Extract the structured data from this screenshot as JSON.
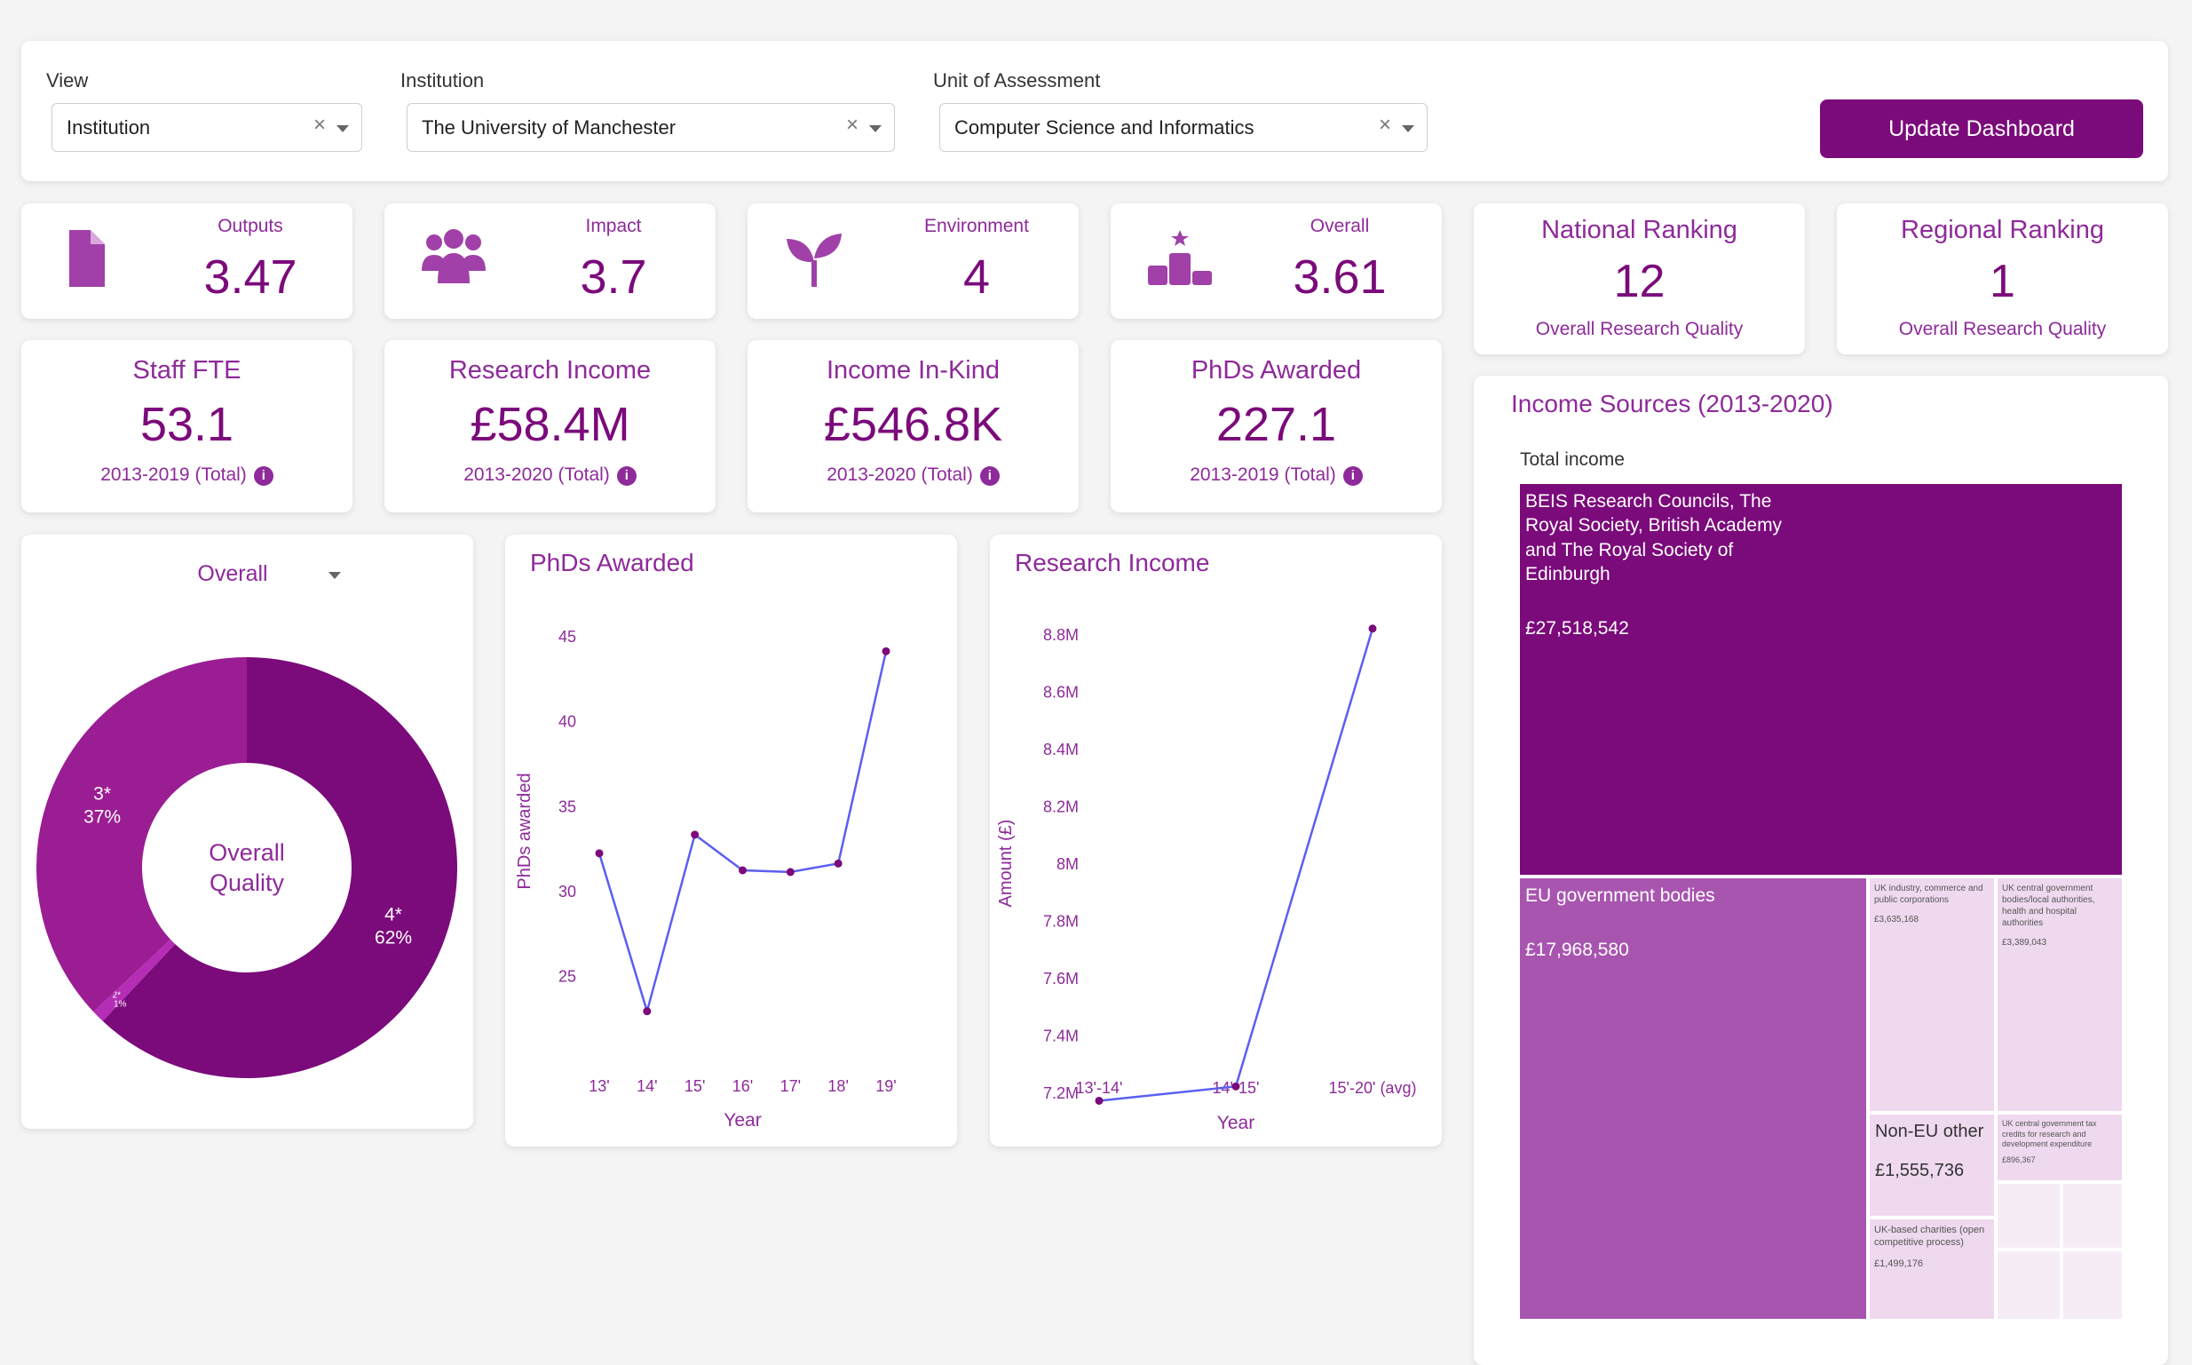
{
  "filters": {
    "view": {
      "label": "View",
      "value": "Institution"
    },
    "institution": {
      "label": "Institution",
      "value": "The University of Manchester"
    },
    "unit": {
      "label": "Unit of Assessment",
      "value": "Computer Science and Informatics"
    },
    "clear_glyph": "×",
    "update_label": "Update Dashboard"
  },
  "scores": [
    {
      "label": "Outputs",
      "value": "3.47",
      "icon": "document-icon"
    },
    {
      "label": "Impact",
      "value": "3.7",
      "icon": "people-icon"
    },
    {
      "label": "Environment",
      "value": "4",
      "icon": "sprout-icon"
    },
    {
      "label": "Overall",
      "value": "3.61",
      "icon": "podium-icon"
    }
  ],
  "rankings": [
    {
      "label": "National Ranking",
      "value": "12",
      "sub": "Overall Research Quality"
    },
    {
      "label": "Regional Ranking",
      "value": "1",
      "sub": "Overall Research Quality"
    }
  ],
  "stats": [
    {
      "label": "Staff FTE",
      "value": "53.1",
      "sub": "2013-2019 (Total)"
    },
    {
      "label": "Research Income",
      "value": "£58.4M",
      "sub": "2013-2020 (Total)"
    },
    {
      "label": "Income In-Kind",
      "value": "£546.8K",
      "sub": "2013-2020 (Total)"
    },
    {
      "label": "PhDs Awarded",
      "value": "227.1",
      "sub": "2013-2019 (Total)"
    }
  ],
  "info_glyph": "i",
  "colors": {
    "accent": "#7b0a7b",
    "text_accent": "#8e2a9a",
    "line": "#5b5ff0",
    "mid": "#a855b0",
    "light": "#efd9ef"
  },
  "chart_data": [
    {
      "type": "pie",
      "dropdown_value": "Overall",
      "center_label": [
        "Overall",
        "Quality"
      ],
      "slices": [
        {
          "name": "4*",
          "value": 62,
          "pct_label": "62%",
          "color": "#7b0a7b"
        },
        {
          "name": "2*",
          "value": 1,
          "pct_label": "1%",
          "color": "#b52db5"
        },
        {
          "name": "3*",
          "value": 37,
          "pct_label": "37%",
          "color": "#9b1d93"
        }
      ]
    },
    {
      "type": "line",
      "title": "PhDs Awarded",
      "xlabel": "Year",
      "ylabel": "PhDs awarded",
      "x": [
        "13'",
        "14'",
        "15'",
        "16'",
        "17'",
        "18'",
        "19'"
      ],
      "values": [
        32.2,
        22.9,
        33.3,
        31.2,
        31.1,
        31.6,
        44.1
      ],
      "yticks": [
        25,
        30,
        35,
        40,
        45
      ],
      "ylim": [
        21,
        46
      ]
    },
    {
      "type": "line",
      "title": "Research Income",
      "xlabel": "Year",
      "ylabel": "Amount (£)",
      "x": [
        "13'-14'",
        "14'-15'",
        "15'-20' (avg)"
      ],
      "values": [
        7.17,
        7.22,
        8.82
      ],
      "ytick_values": [
        7.2,
        7.4,
        7.6,
        7.8,
        8.0,
        8.2,
        8.4,
        8.6,
        8.8
      ],
      "ytick_labels": [
        "7.2M",
        "7.4M",
        "7.6M",
        "7.8M",
        "8M",
        "8.2M",
        "8.4M",
        "8.6M",
        "8.8M"
      ],
      "ylim": [
        7.1,
        8.9
      ]
    },
    {
      "type": "treemap",
      "title": "Income Sources (2013-2020)",
      "root_label": "Total income",
      "items": [
        {
          "name": "BEIS Research Councils, The Royal Society, British Academy and The Royal Society of Edinburgh",
          "value": "£27,518,542"
        },
        {
          "name": "EU government bodies",
          "value": "£17,968,580"
        },
        {
          "name": "UK industry, commerce and public corporations",
          "value": "£3,635,168"
        },
        {
          "name": "UK central government bodies/local authorities, health and hospital authorities",
          "value": "£3,389,043"
        },
        {
          "name": "Non-EU other",
          "value": "£1,555,736"
        },
        {
          "name": "UK central government tax credits for research and development expenditure",
          "value": "£896,367"
        },
        {
          "name": "UK-based charities (open competitive process)",
          "value": "£1,499,176"
        }
      ]
    }
  ]
}
